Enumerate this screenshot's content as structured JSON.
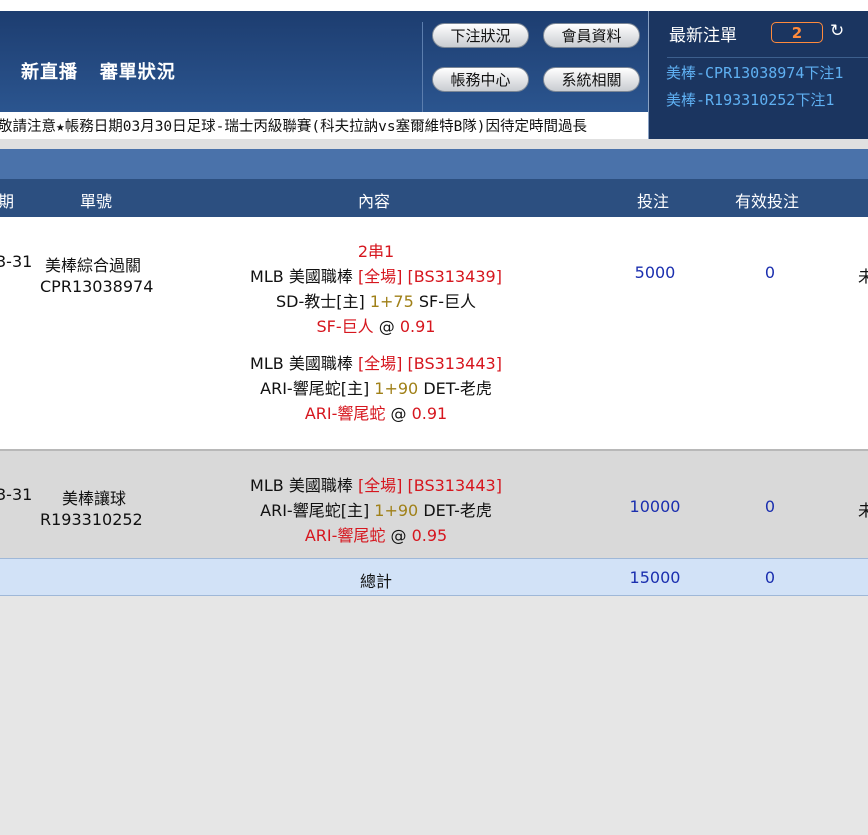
{
  "header": {
    "title_live": "新直播",
    "title_review": "審單狀況",
    "buttons": {
      "bet_status": "下注狀況",
      "member_info": "會員資料",
      "account_center": "帳務中心",
      "system": "系統相關"
    }
  },
  "latest": {
    "title": "最新注單",
    "count": "2",
    "refresh_icon": "↻",
    "items": [
      "美棒-CPR13038974下注1",
      "美棒-R193310252下注1"
    ]
  },
  "marquee": "敬請注意★帳務日期03月30日足球-瑞士丙級聯賽(科夫拉訥vs塞爾維特B隊)因待定時間過長",
  "table": {
    "headers": {
      "date": "期",
      "ticket": "單號",
      "content": "內容",
      "stake": "投注",
      "valid": "有效投注"
    },
    "rows": [
      {
        "date": "3-31",
        "type": "美棒綜合過關",
        "ticket": "CPR13038974",
        "parlay": "2串1",
        "legs": [
          {
            "league": "MLB 美國職棒",
            "period": "[全場]",
            "code": "[BS313439]",
            "home": "SD-教士[主]",
            "line": "1+75",
            "away": "SF-巨人",
            "pick": "SF-巨人",
            "at": "@",
            "odds": "0.91"
          },
          {
            "league": "MLB 美國職棒",
            "period": "[全場]",
            "code": "[BS313443]",
            "home": "ARI-響尾蛇[主]",
            "line": "1+90",
            "away": "DET-老虎",
            "pick": "ARI-響尾蛇",
            "at": "@",
            "odds": "0.91"
          }
        ],
        "stake": "5000",
        "valid": "0",
        "status": "未"
      },
      {
        "date": "3-31",
        "type": "美棒讓球",
        "ticket": "R193310252",
        "legs": [
          {
            "league": "MLB 美國職棒",
            "period": "[全場]",
            "code": "[BS313443]",
            "home": "ARI-響尾蛇[主]",
            "line": "1+90",
            "away": "DET-老虎",
            "pick": "ARI-響尾蛇",
            "at": "@",
            "odds": "0.95"
          }
        ],
        "stake": "10000",
        "valid": "0",
        "status": "未"
      }
    ],
    "total": {
      "label": "總計",
      "stake": "15000",
      "valid": "0"
    }
  }
}
